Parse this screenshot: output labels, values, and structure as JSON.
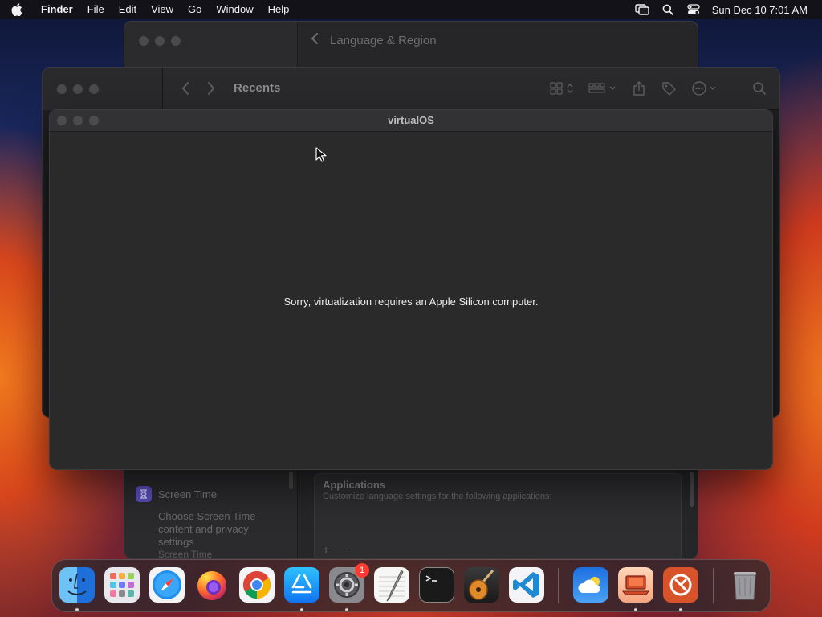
{
  "menubar": {
    "app_name": "Finder",
    "items": [
      "File",
      "Edit",
      "View",
      "Go",
      "Window",
      "Help"
    ],
    "clock": "Sun Dec 10  7:01 AM",
    "status_icons": [
      "screen-mirroring-icon",
      "spotlight-search-icon",
      "control-center-icon"
    ]
  },
  "settings_window": {
    "title": "Language & Region",
    "sidebar_item": "Screen Time",
    "sidebar_item_desc": "Choose Screen Time content and privacy settings",
    "sidebar_next_item": "Screen Time",
    "apps_title": "Applications",
    "apps_desc": "Customize language settings for the following applications:",
    "add_label": "+",
    "remove_label": "−"
  },
  "finder_window": {
    "location": "Recents",
    "toolbar_icons": [
      "back-icon",
      "forward-icon",
      "icon-view-icon",
      "group-icon",
      "share-icon",
      "tag-icon",
      "more-actions-icon",
      "search-icon"
    ]
  },
  "virtualos_window": {
    "title": "virtualOS",
    "message": "Sorry, virtualization requires an Apple Silicon computer."
  },
  "dock": {
    "apps": [
      {
        "name": "Finder",
        "running": true
      },
      {
        "name": "Launchpad",
        "running": false
      },
      {
        "name": "Safari",
        "running": false
      },
      {
        "name": "Firefox",
        "running": false
      },
      {
        "name": "Google Chrome",
        "running": false
      },
      {
        "name": "App Store",
        "running": true
      },
      {
        "name": "System Settings",
        "running": true,
        "badge": "1"
      },
      {
        "name": "TextEdit",
        "running": false
      },
      {
        "name": "Terminal",
        "running": false
      },
      {
        "name": "GarageBand",
        "running": false
      },
      {
        "name": "Visual Studio Code",
        "running": false
      },
      {
        "name": "Weather",
        "running": false
      },
      {
        "name": "virtualOS",
        "running": true
      },
      {
        "name": "Microsoft Remote Desktop",
        "running": true
      },
      {
        "name": "Trash",
        "running": false
      }
    ]
  }
}
